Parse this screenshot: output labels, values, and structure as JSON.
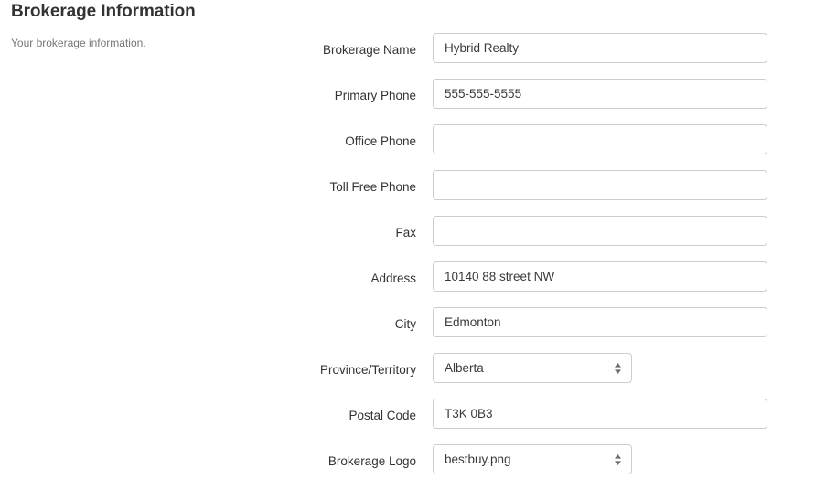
{
  "section": {
    "title": "Brokerage Information",
    "subtitle": "Your brokerage information."
  },
  "form": {
    "fields": [
      {
        "label": "Brokerage Name",
        "type": "text",
        "value": "Hybrid Realty",
        "placeholder": ""
      },
      {
        "label": "Primary Phone",
        "type": "text",
        "value": "555-555-5555",
        "placeholder": ""
      },
      {
        "label": "Office Phone",
        "type": "text",
        "value": "",
        "placeholder": ""
      },
      {
        "label": "Toll Free Phone",
        "type": "text",
        "value": "",
        "placeholder": ""
      },
      {
        "label": "Fax",
        "type": "text",
        "value": "",
        "placeholder": ""
      },
      {
        "label": "Address",
        "type": "text",
        "value": "10140 88 street NW",
        "placeholder": ""
      },
      {
        "label": "City",
        "type": "text",
        "value": "Edmonton",
        "placeholder": ""
      },
      {
        "label": "Province/Territory",
        "type": "select",
        "value": "Alberta",
        "placeholder": ""
      },
      {
        "label": "Postal Code",
        "type": "text",
        "value": "T3K 0B3",
        "placeholder": ""
      },
      {
        "label": "Brokerage Logo",
        "type": "select",
        "value": "bestbuy.png",
        "placeholder": ""
      }
    ]
  },
  "colors": {
    "text": "#333333",
    "muted": "#777777",
    "input_text": "#3a3a3a",
    "border": "#cccccc",
    "background": "#ffffff"
  }
}
